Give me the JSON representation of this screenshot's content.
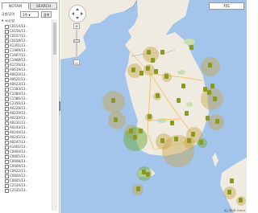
{
  "sidebar": {
    "tabs": [
      {
        "label": "NOTAM",
        "active": true
      },
      {
        "label": "SEARCH",
        "active": false
      }
    ],
    "filter": {
      "label": "공항/공역",
      "selected": "1주",
      "button_label": "검색"
    },
    "tree_root": "국공항",
    "items": [
      "C0154/13",
      "C0156/13",
      "C0157/13",
      "C0158/13",
      "A1301/13",
      "C1969/13",
      "C1667/13",
      "C1668/13",
      "A1726/13",
      "A0619/13",
      "A0620/13",
      "A0621/13",
      "A0623/13",
      "C1583/13",
      "C1584/13",
      "C1586/13",
      "C2356/13",
      "A0228/13",
      "A0229/13",
      "A0230/13",
      "A0231/13",
      "A0243/13",
      "A0244/13",
      "A0245/13",
      "A0247/13",
      "A1461/13",
      "C0604/13",
      "C0605/13",
      "C0608/13",
      "C0609/13",
      "C0622/13",
      "C0604/13",
      "C0605/13",
      "C2534/13",
      "C2535/13"
    ]
  },
  "map": {
    "type_control_label": "지도",
    "attribution": "지도 데이터 ©2013",
    "colors": {
      "water": "#a3c5ec",
      "land": "#f0ebe1",
      "circle_gold": "#c8a44a",
      "circle_green": "#6dab3c",
      "marker": "#8a9a1e"
    },
    "circle_count": 22,
    "marker_count": 38
  }
}
